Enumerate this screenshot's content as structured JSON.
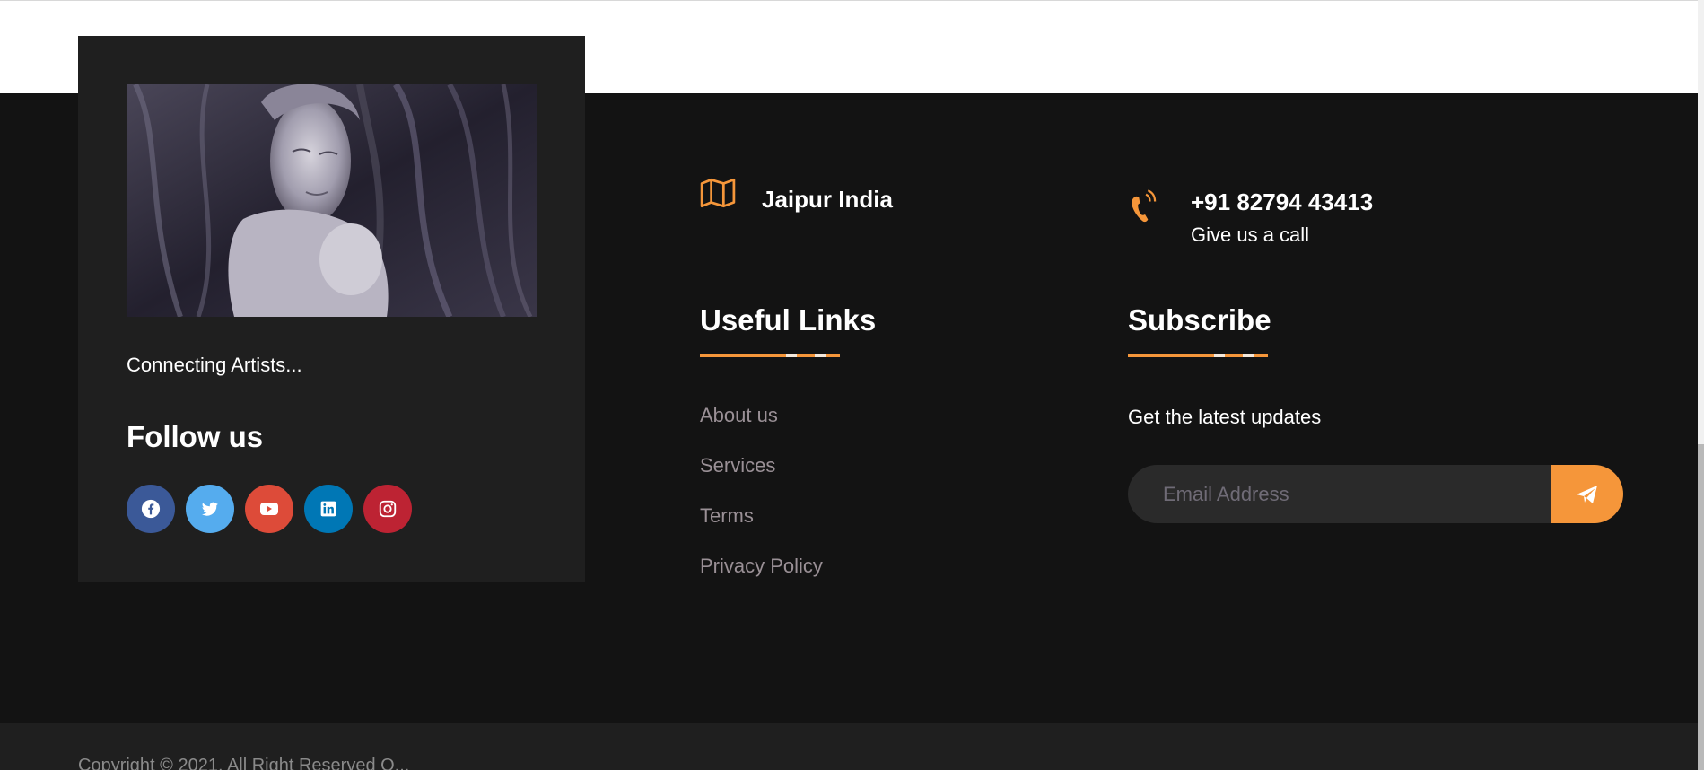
{
  "colors": {
    "accent": "#f5963a",
    "footer_bg": "#131313",
    "card_bg": "#1f1f1f",
    "link": "#9a9096",
    "facebook": "#3b5998",
    "twitter": "#55acee",
    "youtube": "#dd4b39",
    "linkedin": "#0077b5",
    "instagram": "#bd2333"
  },
  "about": {
    "tagline": "Connecting Artists...",
    "follow_title": "Follow us",
    "socials": [
      {
        "name": "facebook",
        "icon": "facebook-icon"
      },
      {
        "name": "twitter",
        "icon": "twitter-icon"
      },
      {
        "name": "youtube",
        "icon": "youtube-icon"
      },
      {
        "name": "linkedin",
        "icon": "linkedin-icon"
      },
      {
        "name": "instagram",
        "icon": "instagram-icon"
      }
    ]
  },
  "contact": {
    "location": {
      "title": "Jaipur India",
      "icon": "map-icon"
    },
    "phone": {
      "title": "+91 82794 43413",
      "subtitle": "Give us a call",
      "icon": "phone-icon"
    }
  },
  "useful_links": {
    "title": "Useful Links",
    "items": [
      "About us",
      "Services",
      "Terms",
      "Privacy Policy"
    ]
  },
  "subscribe": {
    "title": "Subscribe",
    "text": "Get the latest updates",
    "placeholder": "Email Address",
    "button_icon": "send-icon"
  },
  "footer": {
    "copyright": "Copyright © 2021. All Right Reserved O..."
  }
}
